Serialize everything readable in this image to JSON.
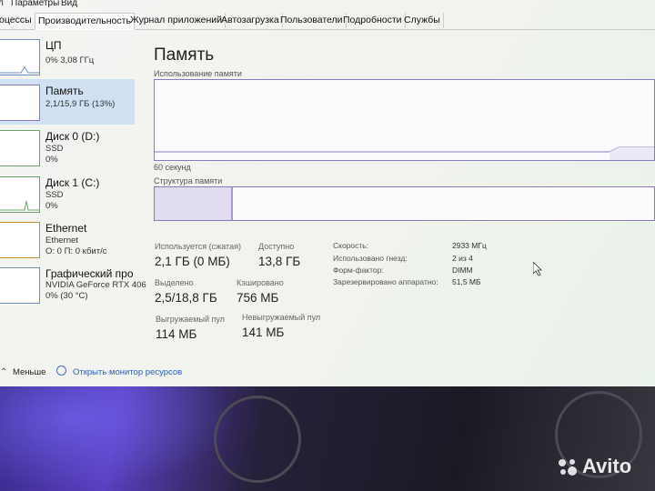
{
  "menubar": [
    "л",
    "Параметры",
    "Вид"
  ],
  "tabs": [
    {
      "label": "оцессы",
      "active": false
    },
    {
      "label": "Производительность",
      "active": true
    },
    {
      "label": "Журнал приложений",
      "active": false
    },
    {
      "label": "Автозагрузка",
      "active": false
    },
    {
      "label": "Пользователи",
      "active": false
    },
    {
      "label": "Подробности",
      "active": false
    },
    {
      "label": "Службы",
      "active": false
    }
  ],
  "sidebar": {
    "items": [
      {
        "title": "ЦП",
        "sub1": "0% 3,08 ГГц",
        "sub2": ""
      },
      {
        "title": "Память",
        "sub1": "2,1/15,9 ГБ (13%)",
        "sub2": ""
      },
      {
        "title": "Диск 0 (D:)",
        "sub1": "SSD",
        "sub2": "0%"
      },
      {
        "title": "Диск 1 (C:)",
        "sub1": "SSD",
        "sub2": "0%"
      },
      {
        "title": "Ethernet",
        "sub1": "Ethernet",
        "sub2": "О: 0 П: 0 кбит/с"
      },
      {
        "title": "Графический про",
        "sub1": "NVIDIA GeForce RTX 406",
        "sub2": "0% (30 °C)"
      }
    ]
  },
  "main": {
    "title": "Память",
    "usage_label": "Использование памяти",
    "time_label": "60 секунд",
    "structure_label": "Структура памяти",
    "stats": {
      "in_use_label": "Используется (сжатая)",
      "in_use_value": "2,1 ГБ (0 МБ)",
      "available_label": "Доступно",
      "available_value": "13,8 ГБ",
      "committed_label": "Выделено",
      "committed_value": "2,5/18,8 ГБ",
      "cached_label": "Кэшировано",
      "cached_value": "756 МБ",
      "paged_label": "Выгружаемый пул",
      "paged_value": "114 МБ",
      "nonpaged_label": "Невыгружаемый пул",
      "nonpaged_value": "141 МБ"
    },
    "specs": [
      {
        "label": "Скорость:",
        "value": "2933 МГц"
      },
      {
        "label": "Использовано гнезд:",
        "value": "2 из 4"
      },
      {
        "label": "Форм-фактор:",
        "value": "DIMM"
      },
      {
        "label": "Зарезервировано аппаратно:",
        "value": "51,5 МБ"
      }
    ]
  },
  "footer": {
    "less_label": "Меньше",
    "resource_monitor_label": "Открыть монитор ресурсов"
  },
  "watermark": "Avito",
  "colors": {
    "selected": "#cfe1f3",
    "memory_border": "#8a7bb8",
    "link": "#2a5fb0"
  }
}
